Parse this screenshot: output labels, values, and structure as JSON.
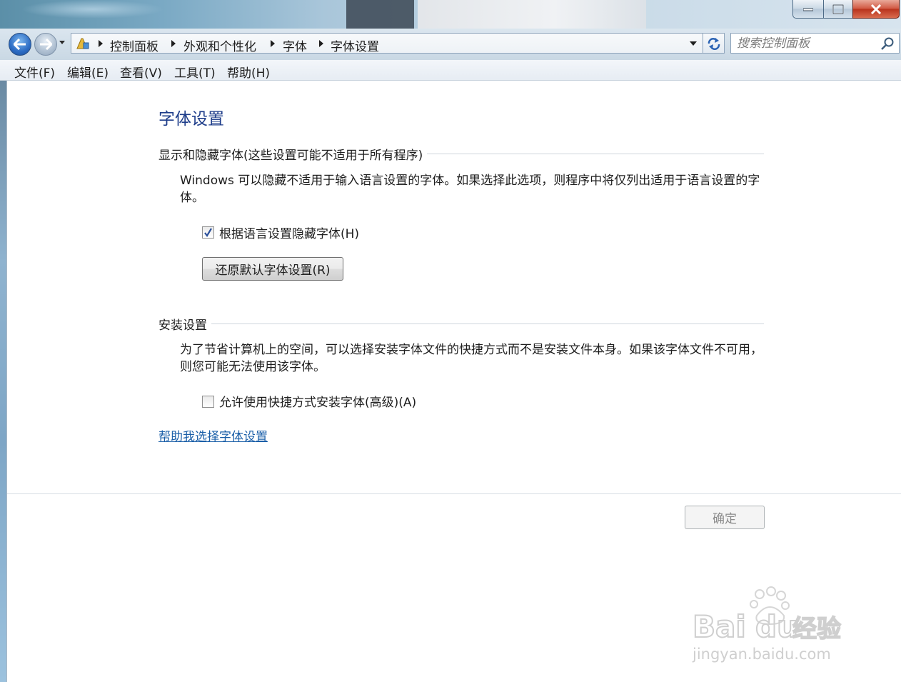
{
  "window": {
    "controls": {
      "minimize": "minimize",
      "maximize": "maximize",
      "close": "close"
    }
  },
  "address_bar": {
    "breadcrumbs": [
      "控制面板",
      "外观和个性化",
      "字体",
      "字体设置"
    ]
  },
  "search": {
    "placeholder": "搜索控制面板"
  },
  "menu": {
    "items": [
      "文件(F)",
      "编辑(E)",
      "查看(V)",
      "工具(T)",
      "帮助(H)"
    ]
  },
  "page": {
    "title": "字体设置",
    "section1": {
      "heading": "显示和隐藏字体(这些设置可能不适用于所有程序)",
      "description": "Windows 可以隐藏不适用于输入语言设置的字体。如果选择此选项，则程序中将仅列出适用于语言设置的字体。",
      "checkbox_label": "根据语言设置隐藏字体(H)",
      "checkbox_checked": true,
      "restore_button": "还原默认字体设置(R)"
    },
    "section2": {
      "heading": "安装设置",
      "description": "为了节省计算机上的空间，可以选择安装字体文件的快捷方式而不是安装文件本身。如果该字体文件不可用，则您可能无法使用该字体。",
      "checkbox_label": "允许使用快捷方式安装字体(高级)(A)",
      "checkbox_checked": false
    },
    "help_link": "帮助我选择字体设置",
    "ok_button": "确定"
  },
  "watermark": {
    "brand": "Baidu经验",
    "url": "jingyan.baidu.com"
  },
  "colors": {
    "title_blue": "#1e3d8a",
    "link_blue": "#1b5fa8",
    "chrome_blue": "#c9d8e4"
  }
}
